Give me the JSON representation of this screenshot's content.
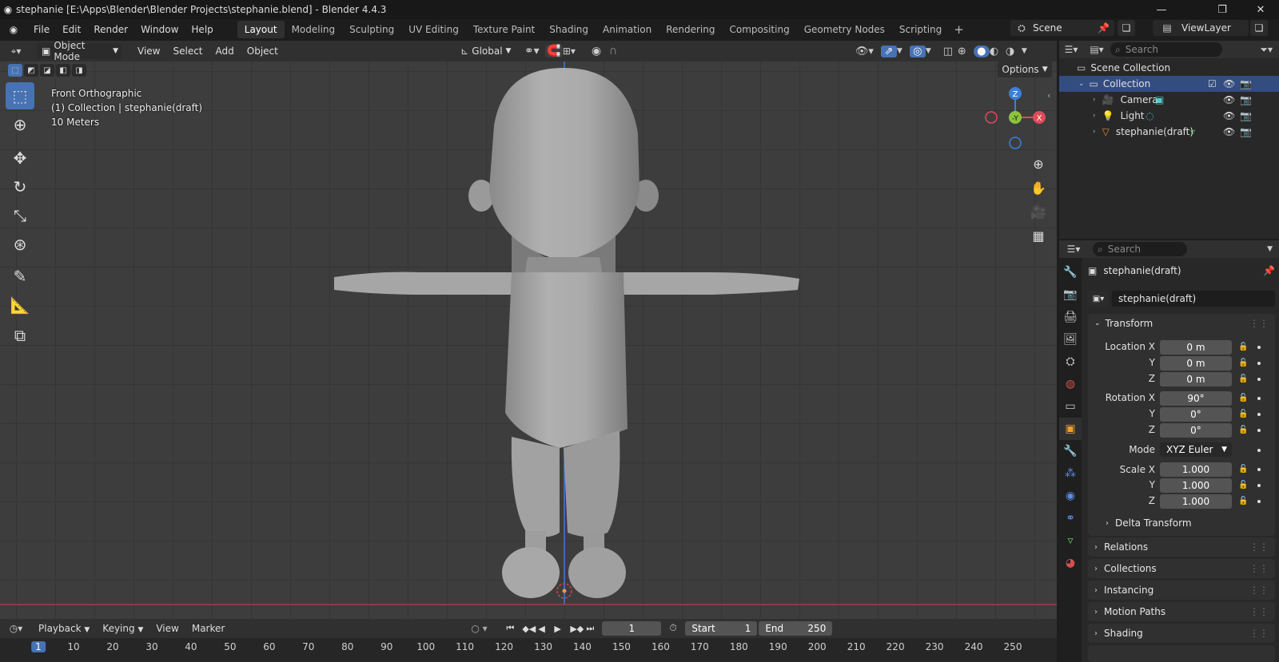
{
  "titlebar": {
    "title": "stephanie [E:\\Apps\\Blender\\Blender Projects\\stephanie.blend] - Blender 4.4.3"
  },
  "menu": [
    "File",
    "Edit",
    "Render",
    "Window",
    "Help"
  ],
  "workspaces": [
    "Layout",
    "Modeling",
    "Sculpting",
    "UV Editing",
    "Texture Paint",
    "Shading",
    "Animation",
    "Rendering",
    "Compositing",
    "Geometry Nodes",
    "Scripting"
  ],
  "active_workspace": "Layout",
  "scene": {
    "name": "Scene",
    "view_layer": "ViewLayer"
  },
  "viewport_header": {
    "mode": "Object Mode",
    "menus": [
      "View",
      "Select",
      "Add",
      "Object"
    ],
    "orientation": "Global",
    "options_label": "Options"
  },
  "viewport_info": {
    "view": "Front Orthographic",
    "collection": "(1) Collection | stephanie(draft)",
    "scale": "10 Meters"
  },
  "gizmo": {
    "z": "Z",
    "y": "-Y",
    "x": "X"
  },
  "outliner": {
    "search_placeholder": "Search",
    "root": "Scene Collection",
    "collection": "Collection",
    "items": [
      {
        "label": "Camera"
      },
      {
        "label": "Light"
      },
      {
        "label": "stephanie(draft)"
      }
    ]
  },
  "properties": {
    "search_placeholder": "Search",
    "object_name": "stephanie(draft)",
    "datablock_name": "stephanie(draft)",
    "transform": {
      "title": "Transform",
      "location_label": "Location X",
      "location": [
        "0 m",
        "0 m",
        "0 m"
      ],
      "rotation_label": "Rotation X",
      "rotation": [
        "90°",
        "0°",
        "0°"
      ],
      "mode_label": "Mode",
      "mode": "XYZ Euler",
      "scale_label": "Scale X",
      "scale": [
        "1.000",
        "1.000",
        "1.000"
      ],
      "y": "Y",
      "z": "Z"
    },
    "delta": "Delta Transform",
    "sections": [
      "Relations",
      "Collections",
      "Instancing",
      "Motion Paths",
      "Shading"
    ]
  },
  "timeline": {
    "menus": [
      "Playback",
      "Keying",
      "View",
      "Marker"
    ],
    "current_frame": "1",
    "start_label": "Start",
    "start": "1",
    "end_label": "End",
    "end": "250",
    "ruler": [
      "1",
      "10",
      "20",
      "30",
      "40",
      "50",
      "60",
      "70",
      "80",
      "90",
      "100",
      "110",
      "120",
      "130",
      "140",
      "150",
      "160",
      "170",
      "180",
      "190",
      "200",
      "210",
      "220",
      "230",
      "240",
      "250"
    ]
  },
  "colors": {
    "accent": "#4772b3",
    "axis_x": "#e04a5a",
    "axis_y": "#8cc43c",
    "axis_z": "#3a80d9"
  }
}
